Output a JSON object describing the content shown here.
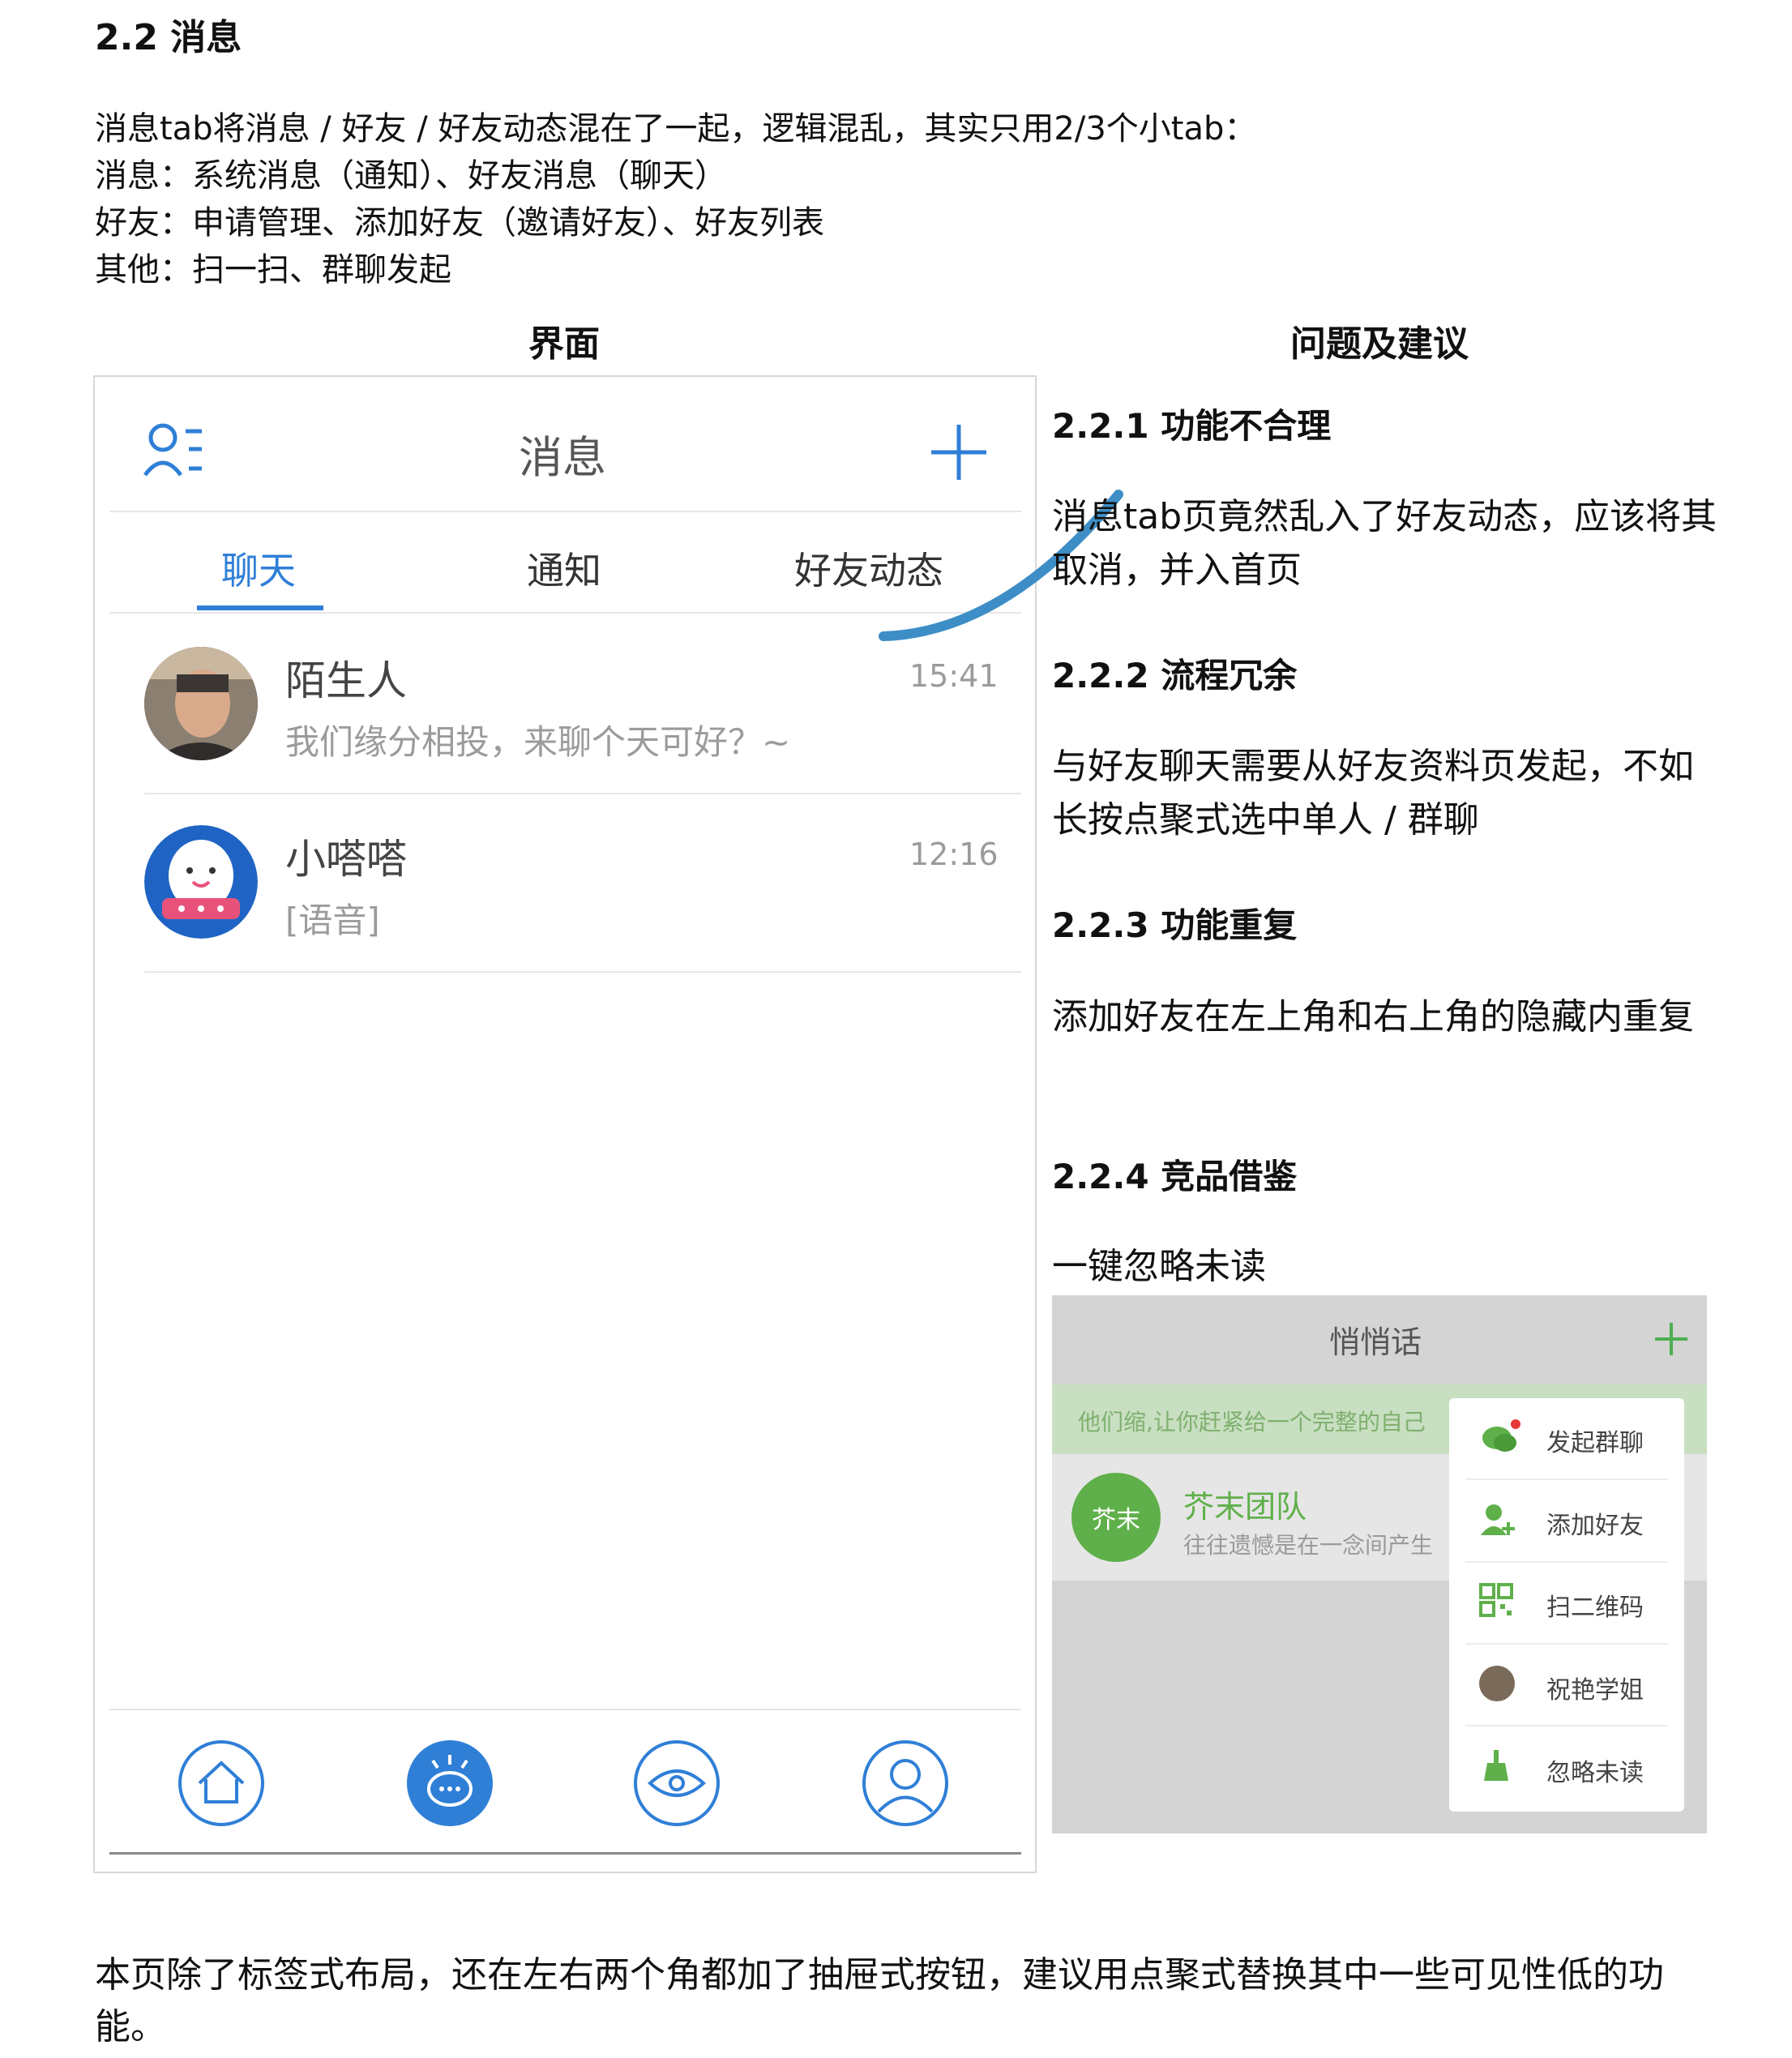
{
  "section_title": "2.2 消息",
  "intro_lines": [
    "消息tab将消息 / 好友 / 好友动态混在了一起，逻辑混乱，其实只用2/3个小tab：",
    "消息：系统消息（通知）、好友消息（聊天）",
    "好友：申请管理、添加好友（邀请好友）、好友列表",
    "其他：扫一扫、群聊发起"
  ],
  "columns": {
    "left": "界面",
    "right": "问题及建议"
  },
  "app": {
    "title": "消息",
    "tabs": [
      "聊天",
      "通知",
      "好友动态"
    ],
    "chats": [
      {
        "name": "陌生人",
        "message": "我们缘分相投，来聊个天可好？~",
        "time": "15:41"
      },
      {
        "name": "小嗒嗒",
        "message": "[语音]",
        "time": "12:16"
      }
    ],
    "icons": {
      "top_left": "friends-list-icon",
      "top_right": "plus-icon",
      "nav": [
        "home-icon",
        "chat-bubble-icon",
        "eye-icon",
        "profile-icon"
      ]
    },
    "accent": "#2f7fd7"
  },
  "issues": [
    {
      "heading": "2.2.1 功能不合理",
      "text": "消息tab页竟然乱入了好友动态，应该将其取消，并入首页"
    },
    {
      "heading": "2.2.2 流程冗余",
      "text": "与好友聊天需要从好友资料页发起，不如长按点聚式选中单人 / 群聊"
    },
    {
      "heading": "2.2.3 功能重复",
      "text": "添加好友在左上角和右上角的隐藏内重复"
    },
    {
      "heading": "2.2.4 竞品借鉴",
      "text": "一键忽略未读"
    }
  ],
  "competitor": {
    "title": "悄悄话",
    "banner": "他们缩,让你赶紧给一个完整的自己",
    "chat_name": "芥末团队",
    "chat_avatar_text": "芥末",
    "chat_msg": "往往遗憾是在一念间产生",
    "menu": [
      "发起群聊",
      "添加好友",
      "扫二维码",
      "祝艳学姐",
      "忽略未读"
    ],
    "accent": "#4caf50"
  },
  "footer": "本页除了标签式布局，还在左右两个角都加了抽屉式按钮，建议用点聚式替换其中一些可见性低的功能。"
}
